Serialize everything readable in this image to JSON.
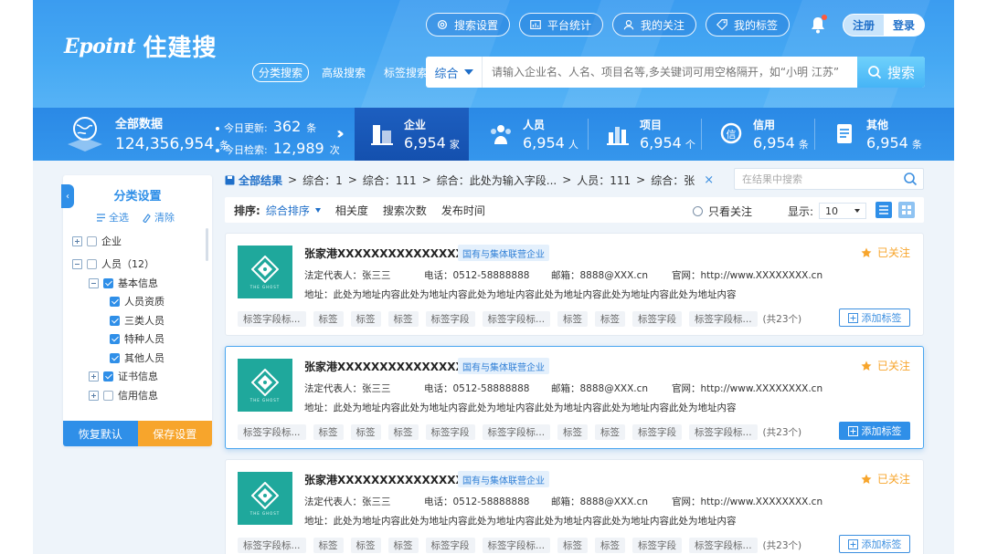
{
  "brand": {
    "en": "Epoint",
    "cn": "住建搜"
  },
  "top_nav": [
    {
      "label": "搜索设置",
      "icon": "gear-icon"
    },
    {
      "label": "平台统计",
      "icon": "chart-icon"
    },
    {
      "label": "我的关注",
      "icon": "user-icon"
    },
    {
      "label": "我的标签",
      "icon": "tag-icon"
    }
  ],
  "auth": {
    "register": "注册",
    "login": "登录"
  },
  "search_modes": [
    "分类搜索",
    "高级搜索",
    "标签搜索"
  ],
  "search": {
    "category": "综合",
    "placeholder": "请输入企业名、人名、项目名等,多关键词可用空格隔开，如“小明 江苏”",
    "button": "搜索"
  },
  "stats": {
    "all_label": "全部数据",
    "all_value": "124,356,954",
    "all_unit": "条",
    "today_update_label": "今日更新:",
    "today_update_value": "362",
    "today_update_unit": "条",
    "today_search_label": "今日检索:",
    "today_search_value": "12,989",
    "today_search_unit": "次",
    "categories": [
      {
        "label": "企业",
        "value": "6,954",
        "unit": "家"
      },
      {
        "label": "人员",
        "value": "6,954",
        "unit": "人"
      },
      {
        "label": "项目",
        "value": "6,954",
        "unit": "个"
      },
      {
        "label": "信用",
        "value": "6,954",
        "unit": "条"
      },
      {
        "label": "其他",
        "value": "6,954",
        "unit": "条"
      }
    ]
  },
  "sidebar": {
    "title": "分类设置",
    "select_all": "全选",
    "clear": "清除",
    "tree": [
      {
        "label": "企业"
      },
      {
        "label": "人员（12）"
      },
      {
        "label": "基本信息"
      },
      {
        "label": "人员资质"
      },
      {
        "label": "三类人员"
      },
      {
        "label": "特种人员"
      },
      {
        "label": "其他人员"
      },
      {
        "label": "证书信息"
      },
      {
        "label": "信用信息"
      }
    ],
    "restore": "恢复默认",
    "save": "保存设置"
  },
  "breadcrumb": {
    "all": "全部结果",
    "items": [
      "综合：1",
      "综合：111",
      "综合：此处为输入字段...",
      "人员：111",
      "综合：张"
    ],
    "close": "×"
  },
  "result_search_placeholder": "在结果中搜索",
  "sort": {
    "label": "排序:",
    "options": [
      "综合排序",
      "相关度",
      "搜索次数",
      "发布时间"
    ],
    "follow_only": "只看关注",
    "display_label": "显示:",
    "display_value": "10"
  },
  "results": [
    {
      "name": "张家港XXXXXXXXXXXXXXXXX",
      "badge": "国有与集体联营企业",
      "fav": "已关注",
      "rep": "法定代表人：张三三",
      "phone": "电话：0512-58888888",
      "email": "邮箱：8888@XXX.cn",
      "site": "官网：http://www.XXXXXXXX.cn",
      "addr": "地址：此处为地址内容此处为地址内容此处为地址内容此处为地址内容此处为地址内容此处为地址内容",
      "tags": [
        "标签字段标...",
        "标签",
        "标签",
        "标签",
        "标签字段",
        "标签字段标...",
        "标签",
        "标签",
        "标签字段",
        "标签字段标..."
      ],
      "count": "(共23个)",
      "add": "添加标签"
    },
    {
      "name": "张家港XXXXXXXXXXXXXXXXX",
      "badge": "国有与集体联营企业",
      "fav": "已关注",
      "rep": "法定代表人：张三三",
      "phone": "电话：0512-58888888",
      "email": "邮箱：8888@XXX.cn",
      "site": "官网：http://www.XXXXXXXX.cn",
      "addr": "地址：此处为地址内容此处为地址内容此处为地址内容此处为地址内容此处为地址内容此处为地址内容",
      "tags": [
        "标签字段标...",
        "标签",
        "标签",
        "标签",
        "标签字段",
        "标签字段标...",
        "标签",
        "标签",
        "标签字段",
        "标签字段标..."
      ],
      "count": "(共23个)",
      "add": "添加标签"
    },
    {
      "name": "张家港XXXXXXXXXXXXXXXXX",
      "badge": "国有与集体联营企业",
      "fav": "已关注",
      "rep": "法定代表人：张三三",
      "phone": "电话：0512-58888888",
      "email": "邮箱：8888@XXX.cn",
      "site": "官网：http://www.XXXXXXXX.cn",
      "addr": "地址：此处为地址内容此处为地址内容此处为地址内容此处为地址内容此处为地址内容此处为地址内容",
      "tags": [
        "标签字段标...",
        "标签",
        "标签",
        "标签",
        "标签字段",
        "标签字段标...",
        "标签",
        "标签",
        "标签字段",
        "标签字段标..."
      ],
      "count": "(共23个)",
      "add": "添加标签"
    }
  ],
  "logo_caption": "THE GHOST",
  "colors": {
    "primary": "#2f8fe8",
    "accent": "#f7a52c",
    "teal": "#1fa89c"
  }
}
